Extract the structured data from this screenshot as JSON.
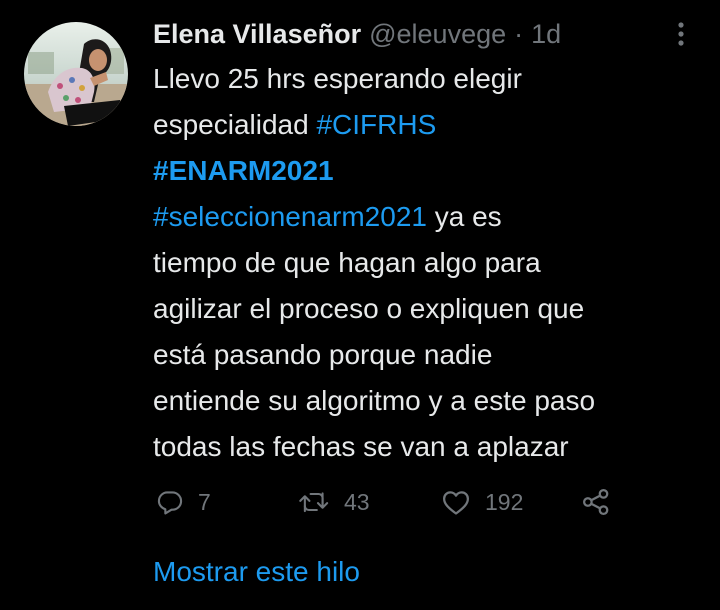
{
  "author": {
    "display_name": "Elena Villaseñor",
    "handle": "@eleuvege",
    "separator": "·",
    "timestamp": "1d",
    "avatar_icon": "profile-photo"
  },
  "tweet": {
    "segments": [
      {
        "text": "Llevo 25 hrs esperando elegir",
        "kind": "text"
      },
      {
        "text": "especialidad ",
        "kind": "text"
      },
      {
        "text": "#CIFRHS",
        "kind": "hashtag"
      },
      {
        "text": "#ENARM2021",
        "kind": "hashtag-bold"
      },
      {
        "text": "#seleccionenarm2021",
        "kind": "hashtag"
      },
      {
        "text": " ya es",
        "kind": "text"
      },
      {
        "text": "tiempo de que hagan algo para",
        "kind": "text"
      },
      {
        "text": "agilizar el proceso o expliquen que",
        "kind": "text"
      },
      {
        "text": "está pasando porque nadie",
        "kind": "text"
      },
      {
        "text": "entiende su algoritmo y a este paso",
        "kind": "text"
      },
      {
        "text": "todas las fechas se van a aplazar",
        "kind": "text"
      }
    ]
  },
  "actions": {
    "reply": {
      "icon": "reply-icon",
      "count": "7"
    },
    "retweet": {
      "icon": "retweet-icon",
      "count": "43"
    },
    "like": {
      "icon": "heart-icon",
      "count": "192"
    },
    "share": {
      "icon": "share-icon"
    }
  },
  "show_thread_label": "Mostrar este hilo",
  "colors": {
    "background": "#000000",
    "text": "#e7e9ea",
    "muted": "#71767b",
    "accent": "#1d9bf0"
  }
}
